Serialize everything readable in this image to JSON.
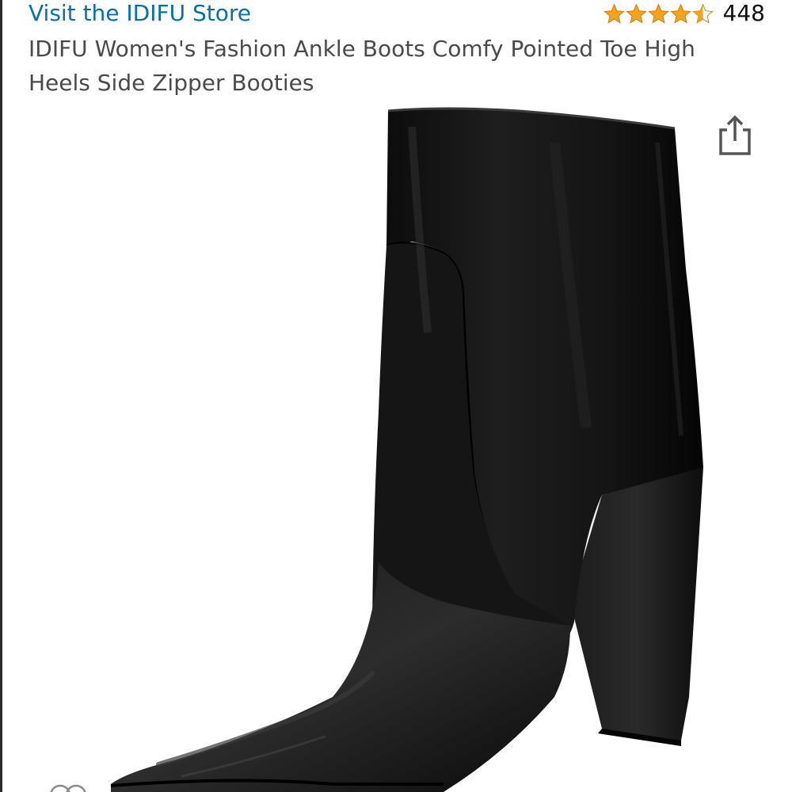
{
  "store": {
    "link_label": "Visit the IDIFU Store",
    "link_color": "#0a6fa8"
  },
  "rating": {
    "stars": 4.5,
    "star_color": "#f6a21a",
    "count": "448"
  },
  "product": {
    "title": "IDIFU Women's Fashion Ankle Boots Comfy Pointed Toe High Heels Side Zipper Booties",
    "image_subject": "black pointed-toe high-heel ankle boot"
  },
  "icons": {
    "share": "share-icon",
    "star": "star-icon",
    "compare": "compare-icon"
  }
}
